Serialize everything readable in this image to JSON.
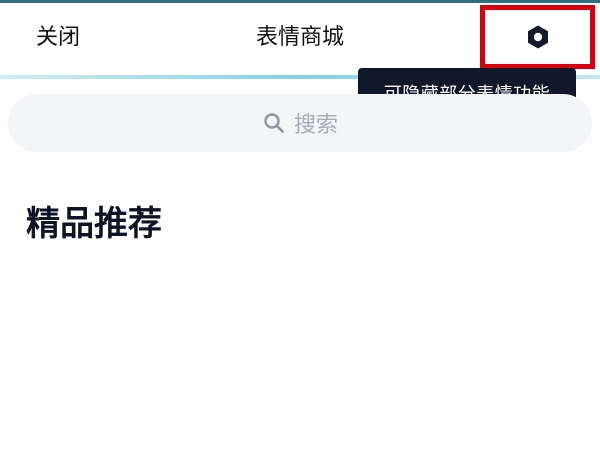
{
  "header": {
    "close_label": "关闭",
    "title": "表情商城",
    "settings_icon": "settings-hex-icon"
  },
  "tooltip": {
    "text": "可隐藏部分表情功能"
  },
  "search": {
    "placeholder": "搜索",
    "icon": "search-icon"
  },
  "section": {
    "title": "精品推荐"
  },
  "colors": {
    "highlight_border": "#d9000d",
    "tooltip_bg": "#12182c",
    "divider_accent": "#7fd3e6",
    "search_bg": "#f4f5f9"
  }
}
